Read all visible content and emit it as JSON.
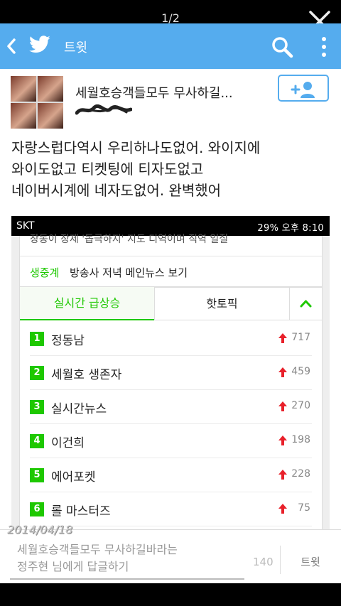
{
  "viewer": {
    "page_indicator": "1/2"
  },
  "app_bar": {
    "title": "트윗",
    "icons": [
      "back-icon",
      "twitter-bird-icon",
      "search-icon",
      "more-icon"
    ],
    "color": "#55acee"
  },
  "tweet": {
    "author_name": "세월호승객들모두 무사하길...",
    "text_lines": [
      "자랑스럽다역시 우리하나도없어. 와이지에",
      "와이도없고 티켓팅에 티자도없고",
      "네이버시계에 네자도없어. 완벽했어"
    ]
  },
  "embedded_screenshot": {
    "status_bar": {
      "carrier": "SKT",
      "right": "29% 오후 8:10"
    },
    "cut_text": "장동이 장제 '돕극하지' 지도 디역이며 직역 일질",
    "news": {
      "tag": "생중계",
      "text": "방송사 저녁 메인뉴스 보기"
    },
    "tabs": {
      "active": "실시간 급상승",
      "other": "핫토픽"
    },
    "accent_color": "#1ec800",
    "rankings": [
      {
        "rank": "1",
        "title": "정동남",
        "count": "717"
      },
      {
        "rank": "2",
        "title": "세월호 생존자",
        "count": "459"
      },
      {
        "rank": "3",
        "title": "실시간뉴스",
        "count": "270"
      },
      {
        "rank": "4",
        "title": "이건희",
        "count": "198"
      },
      {
        "rank": "5",
        "title": "에어포켓",
        "count": "228"
      },
      {
        "rank": "6",
        "title": "롤 마스터즈",
        "count": "75"
      }
    ]
  },
  "date_stamp": "2014/04/18",
  "reply": {
    "placeholder_lines": [
      "세월호승객들모두 무사하길바라는",
      "정주현 님에게 답글하기"
    ],
    "char_count": "140",
    "tweet_button": "트윗"
  }
}
